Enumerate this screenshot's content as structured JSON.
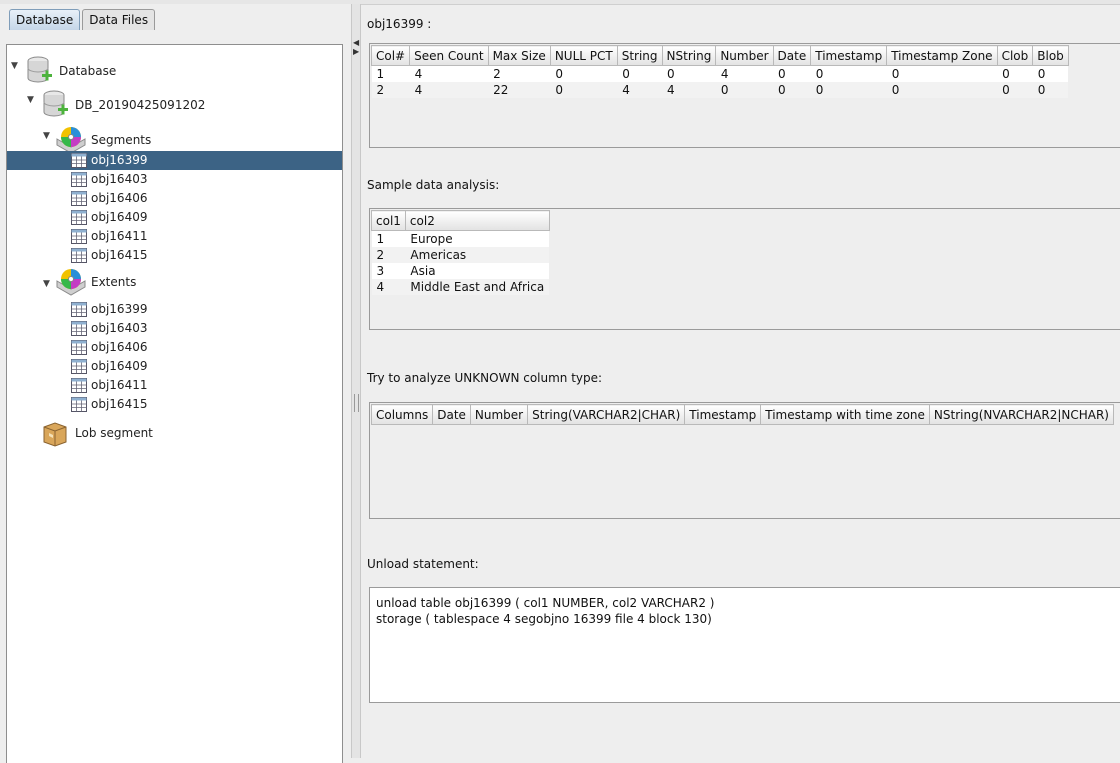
{
  "tabs": [
    {
      "label": "Database",
      "active": true
    },
    {
      "label": "Data Files",
      "active": false
    }
  ],
  "tree": {
    "root": "Database",
    "db": "DB_20190425091202",
    "segments_label": "Segments",
    "segments": [
      "obj16399",
      "obj16403",
      "obj16406",
      "obj16409",
      "obj16411",
      "obj16415"
    ],
    "extents_label": "Extents",
    "extents": [
      "obj16399",
      "obj16403",
      "obj16406",
      "obj16409",
      "obj16411",
      "obj16415"
    ],
    "lob_label": "Lob segment",
    "selected": "obj16399"
  },
  "object_title": "obj16399 :",
  "column_stats": {
    "headers": [
      "Col#",
      "Seen Count",
      "Max Size",
      "NULL PCT",
      "String",
      "NString",
      "Number",
      "Date",
      "Timestamp",
      "Timestamp Zone",
      "Clob",
      "Blob"
    ],
    "rows": [
      [
        "1",
        "4",
        "2",
        "0",
        "0",
        "0",
        "4",
        "0",
        "0",
        "0",
        "0",
        "0"
      ],
      [
        "2",
        "4",
        "22",
        "0",
        "4",
        "4",
        "0",
        "0",
        "0",
        "0",
        "0",
        "0"
      ]
    ]
  },
  "sample_label": "Sample data analysis:",
  "sample": {
    "headers": [
      "col1",
      "col2"
    ],
    "rows": [
      [
        "1",
        "Europe"
      ],
      [
        "2",
        "Americas"
      ],
      [
        "3",
        "Asia"
      ],
      [
        "4",
        "Middle East and Africa"
      ]
    ]
  },
  "unknown_label": "Try to analyze UNKNOWN column type:",
  "unknown": {
    "headers": [
      "Columns",
      "Date",
      "Number",
      "String(VARCHAR2|CHAR)",
      "Timestamp",
      "Timestamp with time zone",
      "NString(NVARCHAR2|NCHAR)"
    ]
  },
  "unload_label": "Unload statement:",
  "unload_lines": [
    "unload table obj16399 ( col1 NUMBER, col2 VARCHAR2 )",
    "storage ( tablespace 4 segobjno 16399 file 4 block 130)"
  ],
  "colors": {
    "selection": "#3c6385",
    "border": "#9a9a9a"
  }
}
